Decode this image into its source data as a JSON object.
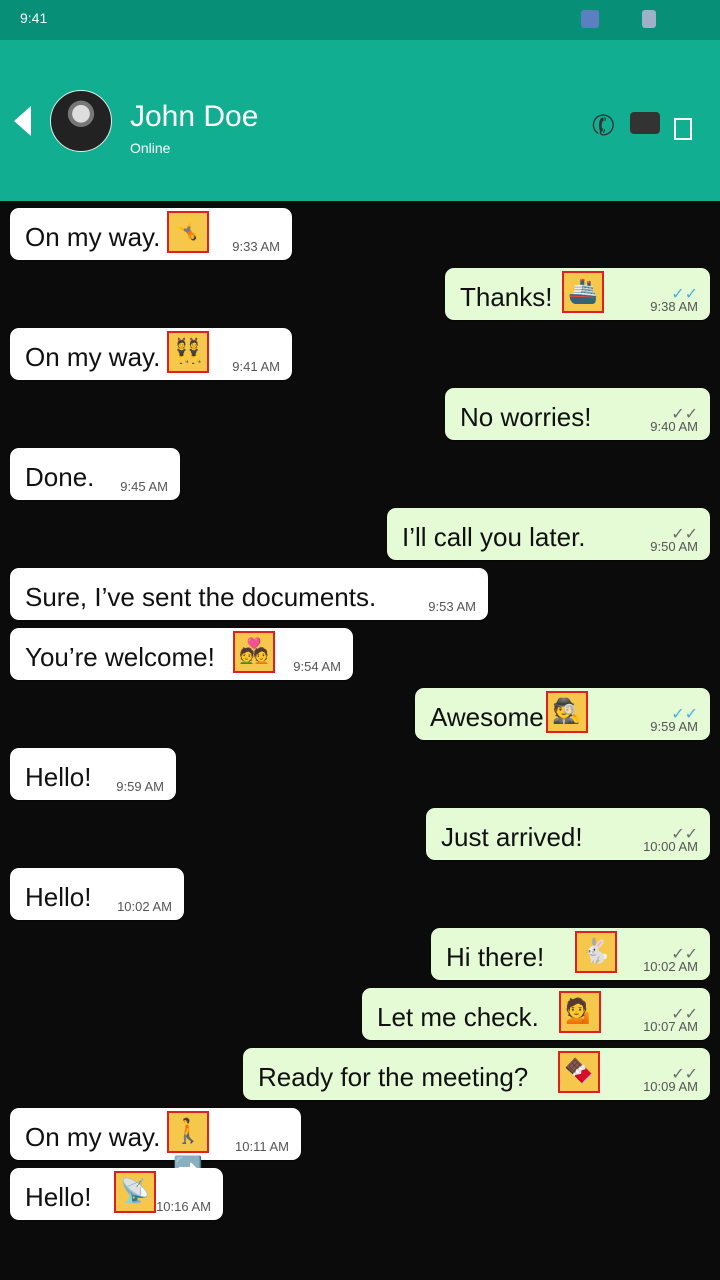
{
  "status_bar": {
    "time": "9:41"
  },
  "header": {
    "name": "John Doe",
    "status": "Online"
  },
  "messages": [
    {
      "dir": "in",
      "text": "On my way.",
      "emoji": "🤸",
      "time": "9:33 AM"
    },
    {
      "dir": "out",
      "text": "Thanks!",
      "emoji": "🚢",
      "time": "9:38 AM",
      "tick": "read"
    },
    {
      "dir": "in",
      "text": "On my way.",
      "emoji": "👯",
      "time": "9:41 AM"
    },
    {
      "dir": "out",
      "text": "No worries!",
      "emoji": "",
      "time": "9:40 AM",
      "tick": "sent"
    },
    {
      "dir": "in",
      "text": "Done.",
      "emoji": "",
      "time": "9:45 AM"
    },
    {
      "dir": "out",
      "text": "I’ll call you later.",
      "emoji": "",
      "time": "9:50 AM",
      "tick": "sent"
    },
    {
      "dir": "in",
      "text": "Sure, I’ve sent the documents.",
      "emoji": "",
      "time": "9:53 AM"
    },
    {
      "dir": "in",
      "text": "You’re welcome!",
      "emoji": "💑",
      "time": "9:54 AM"
    },
    {
      "dir": "out",
      "text": "Awesome!",
      "emoji": "🕵",
      "time": "9:59 AM",
      "tick": "read"
    },
    {
      "dir": "in",
      "text": "Hello!",
      "emoji": "",
      "time": "9:59 AM"
    },
    {
      "dir": "out",
      "text": "Just arrived!",
      "emoji": "",
      "time": "10:00 AM",
      "tick": "sent"
    },
    {
      "dir": "in",
      "text": "Hello!",
      "emoji": "",
      "time": "10:02 AM"
    },
    {
      "dir": "out",
      "text": "Hi there!",
      "emoji": "🐇",
      "time": "10:02 AM",
      "tick": "sent"
    },
    {
      "dir": "out",
      "text": "Let me check.",
      "emoji": "💁",
      "time": "10:07 AM",
      "tick": "sent"
    },
    {
      "dir": "out",
      "text": "Ready for the meeting?",
      "emoji": "🍫",
      "time": "10:09 AM",
      "tick": "sent"
    },
    {
      "dir": "in",
      "text": "On my way.",
      "emoji": "🚶➡️",
      "time": "10:11 AM"
    },
    {
      "dir": "in",
      "text": "Hello!",
      "emoji": "📡",
      "time": "10:16 AM"
    }
  ]
}
